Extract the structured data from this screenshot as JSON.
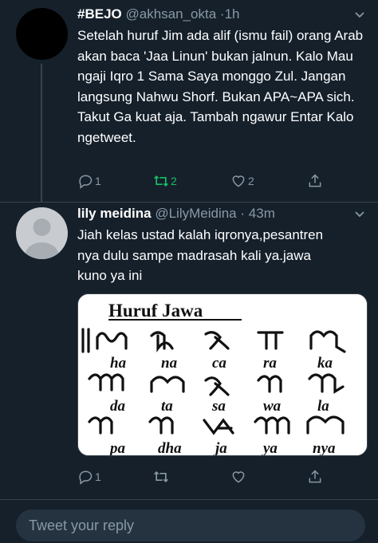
{
  "tweets": [
    {
      "name": "#BEJO",
      "handle": "@akhsan_okta",
      "sep": "·",
      "time": "1h",
      "text": "Setelah huruf Jim ada alif (ismu fail) orang Arab akan baca 'Jaa Linun' bukan jalnun. Kalo Mau ngaji Iqro 1 Sama Saya monggo Zul. Jangan langsung Nahwu Shorf. Bukan APA~APA sich. Takut Ga kuat aja. Tambah ngawur Entar Kalo ngetweet.",
      "replies": "1",
      "retweets": "2",
      "likes": "2",
      "retweeted": true
    },
    {
      "name": "lily meidina",
      "handle": "@LilyMeidina",
      "sep": "·",
      "time": "43m",
      "text": "Jiah kelas ustad kalah iqronya,pesantren nya dulu sampe madrasah kali ya.jawa kuno ya ini",
      "replies": "1",
      "retweets": "",
      "likes": "",
      "retweeted": false,
      "media": {
        "title": "Huruf Jawa",
        "rows": [
          [
            "ha",
            "na",
            "ca",
            "ra",
            "ka"
          ],
          [
            "da",
            "ta",
            "sa",
            "wa",
            "la"
          ],
          [
            "pa",
            "dha",
            "ja",
            "ya",
            "nya"
          ]
        ]
      }
    }
  ],
  "compose": {
    "placeholder": "Tweet your reply"
  },
  "colors": {
    "background": "#15202b",
    "accent": "#1da1f2",
    "muted": "#8899a6",
    "retweet": "#17bf63"
  }
}
